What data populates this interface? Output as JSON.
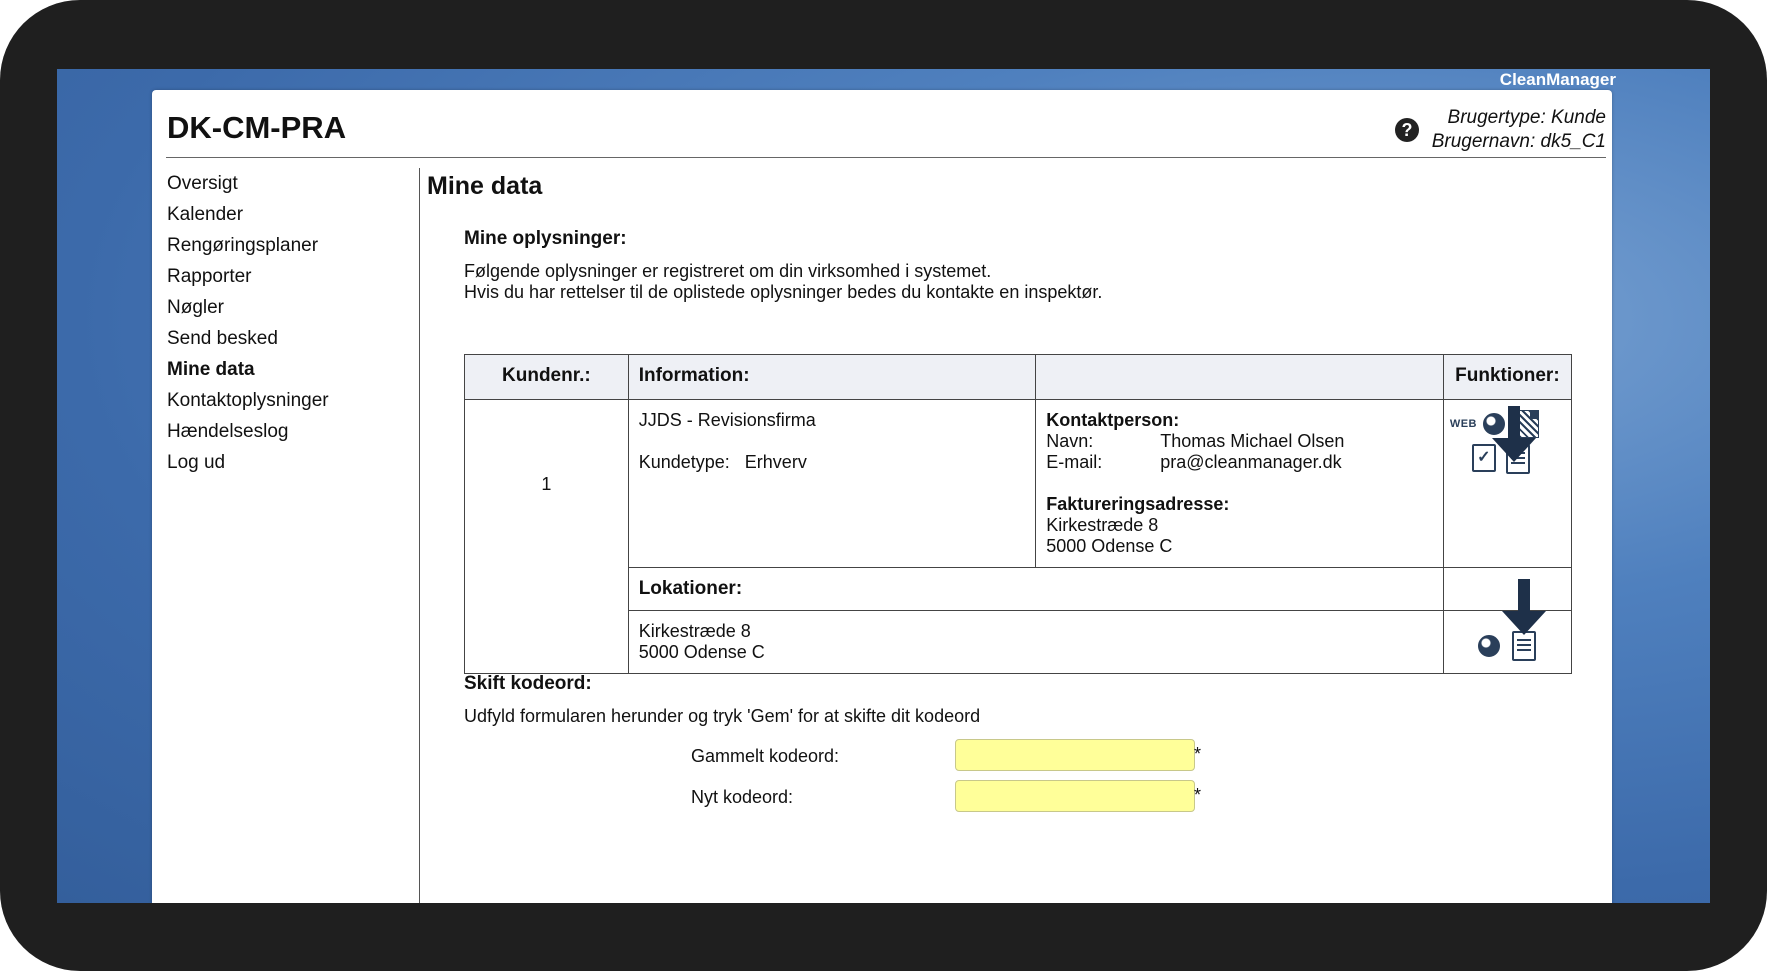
{
  "app": {
    "brand": "CleanManager",
    "site_title": "DK-CM-PRA",
    "user_type": "Brugertype: Kunde",
    "user_name": "Brugernavn: dk5_C1",
    "help_icon": "?"
  },
  "nav": {
    "items": [
      {
        "label": "Oversigt"
      },
      {
        "label": "Kalender"
      },
      {
        "label": "Rengøringsplaner"
      },
      {
        "label": "Rapporter"
      },
      {
        "label": "Nøgler"
      },
      {
        "label": "Send besked"
      },
      {
        "label": "Mine data",
        "active": true
      },
      {
        "label": "Kontaktoplysninger"
      },
      {
        "label": "Hændelseslog"
      },
      {
        "label": "Log ud"
      }
    ]
  },
  "main": {
    "heading": "Mine data",
    "info_section": {
      "title": "Mine oplysninger:",
      "line1": "Følgende oplysninger er registreret om din virksomhed i systemet.",
      "line2": "Hvis du har rettelser til de oplistede oplysninger bedes du kontakte en inspektør."
    },
    "table": {
      "headers": {
        "kundenr": "Kundenr.:",
        "information": "Information:",
        "empty": "",
        "funktioner": "Funktioner:"
      },
      "customer_number": "1",
      "company_name": "JJDS - Revisionsfirma",
      "kundetype_label": "Kundetype:",
      "kundetype_value": "Erhverv",
      "contact_title": "Kontaktperson:",
      "contact_name_label": "Navn:",
      "contact_name": "Thomas Michael Olsen",
      "contact_email_label": "E-mail:",
      "contact_email": "pra@cleanmanager.dk",
      "billing_title": "Faktureringsadresse:",
      "billing_street": "Kirkestræde 8",
      "billing_city": "5000 Odense C",
      "locations_title": "Lokationer:",
      "location_street": "Kirkestræde 8",
      "location_city": "5000 Odense C",
      "web_icon_label": "WEB"
    },
    "password_section": {
      "title": "Skift kodeord:",
      "instructions": "Udfyld formularen herunder og tryk 'Gem' for at skifte dit kodeord",
      "old_label": "Gammelt kodeord:",
      "new_label": "Nyt kodeord:",
      "old_value": "",
      "new_value": "",
      "required_mark": "*"
    }
  },
  "icons": [
    "help-icon",
    "web-icon",
    "globe-icon",
    "qr-code-icon",
    "checklist-icon",
    "document-icon",
    "download-arrow-icon"
  ],
  "colors": {
    "desktop_blue": "#4f80be",
    "input_yellow": "#ffff99",
    "table_header_bg": "#eef0f5",
    "icon_navy": "#1e3049"
  }
}
